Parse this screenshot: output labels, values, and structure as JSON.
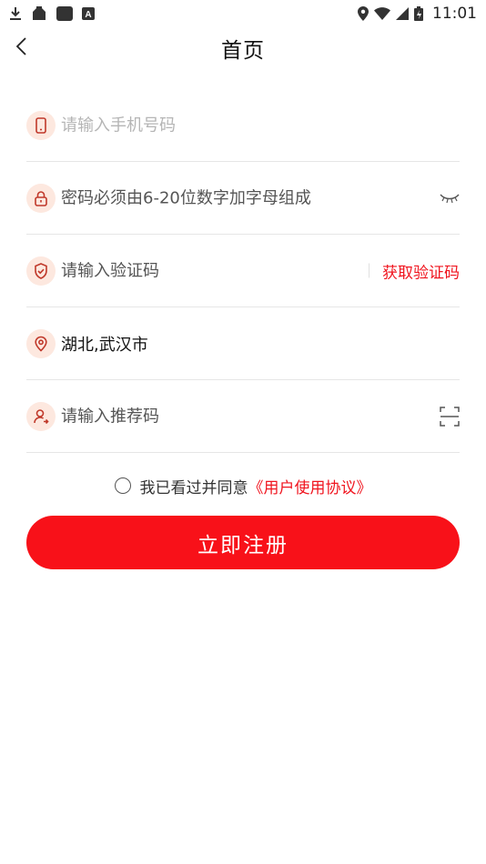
{
  "status_bar": {
    "time": "11:01",
    "left_icons": [
      "download-icon",
      "app-icon",
      "square-icon",
      "a-icon"
    ],
    "right_icons": [
      "location-icon",
      "wifi-icon",
      "signal-icon",
      "battery-icon"
    ]
  },
  "header": {
    "title": "首页",
    "back_icon": "chevron-left-icon"
  },
  "form": {
    "phone": {
      "placeholder": "请输入手机号码",
      "icon": "phone-icon"
    },
    "password": {
      "placeholder": "密码必须由6-20位数字加字母组成",
      "icon": "lock-icon",
      "toggle_icon": "eye-closed-icon"
    },
    "code": {
      "placeholder": "请输入验证码",
      "icon": "shield-icon",
      "get_code_label": "获取验证码"
    },
    "location": {
      "value": "湖北,武汉市",
      "icon": "location-pin-icon"
    },
    "referral": {
      "placeholder": "请输入推荐码",
      "icon": "user-icon",
      "scan_icon": "scan-icon"
    }
  },
  "agreement": {
    "text": "我已看过并同意",
    "link": "《用户使用协议》",
    "checked": false
  },
  "register_button": "立即注册",
  "colors": {
    "accent": "#f81119",
    "link": "#f0141e",
    "icon_circle": "#fde8df",
    "icon_stroke": "#c0392b",
    "divider": "#e6e6e6"
  }
}
